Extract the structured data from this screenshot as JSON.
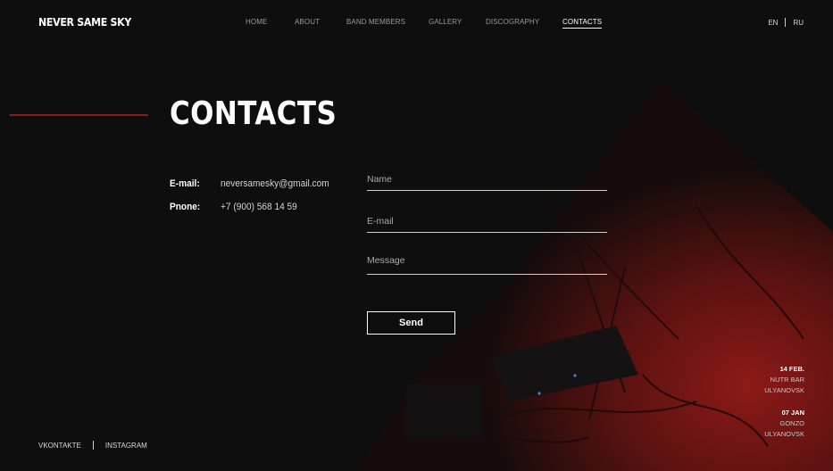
{
  "brand": {
    "logo": "NEVER SAME SKY"
  },
  "nav": {
    "items": [
      {
        "label": "HOME"
      },
      {
        "label": "ABOUT"
      },
      {
        "label": "BAND MEMBERS"
      },
      {
        "label": "GALLERY"
      },
      {
        "label": "DISCOGRAPHY"
      },
      {
        "label": "CONTACTS",
        "active": true
      }
    ]
  },
  "language": {
    "en": "EN",
    "ru": "RU",
    "selected": "EN"
  },
  "page": {
    "title": "CONTACTS"
  },
  "contact": {
    "email_label": "E-mail:",
    "email_value": "neversamesky@gmail.com",
    "phone_label": "Pnone:",
    "phone_value": "+7 (900) 568 14 59"
  },
  "form": {
    "name_placeholder": "Name",
    "email_placeholder": "E-mail",
    "message_placeholder": "Message",
    "send_label": "Send"
  },
  "social": {
    "vk": "VKONTAKTE",
    "instagram": "INSTAGRAM"
  },
  "events": [
    {
      "date": "14 FEB.",
      "venue": "NUTR BAR",
      "city": "ULYANOVSK"
    },
    {
      "date": "07 JAN",
      "venue": "GONZO",
      "city": "ULYANOVSK"
    }
  ],
  "colors": {
    "background": "#0e0e0e",
    "accent_line": "#8e1d1a",
    "stage_red": "#7a1714",
    "text": "#ffffff",
    "muted_text": "#9a9a9a"
  }
}
